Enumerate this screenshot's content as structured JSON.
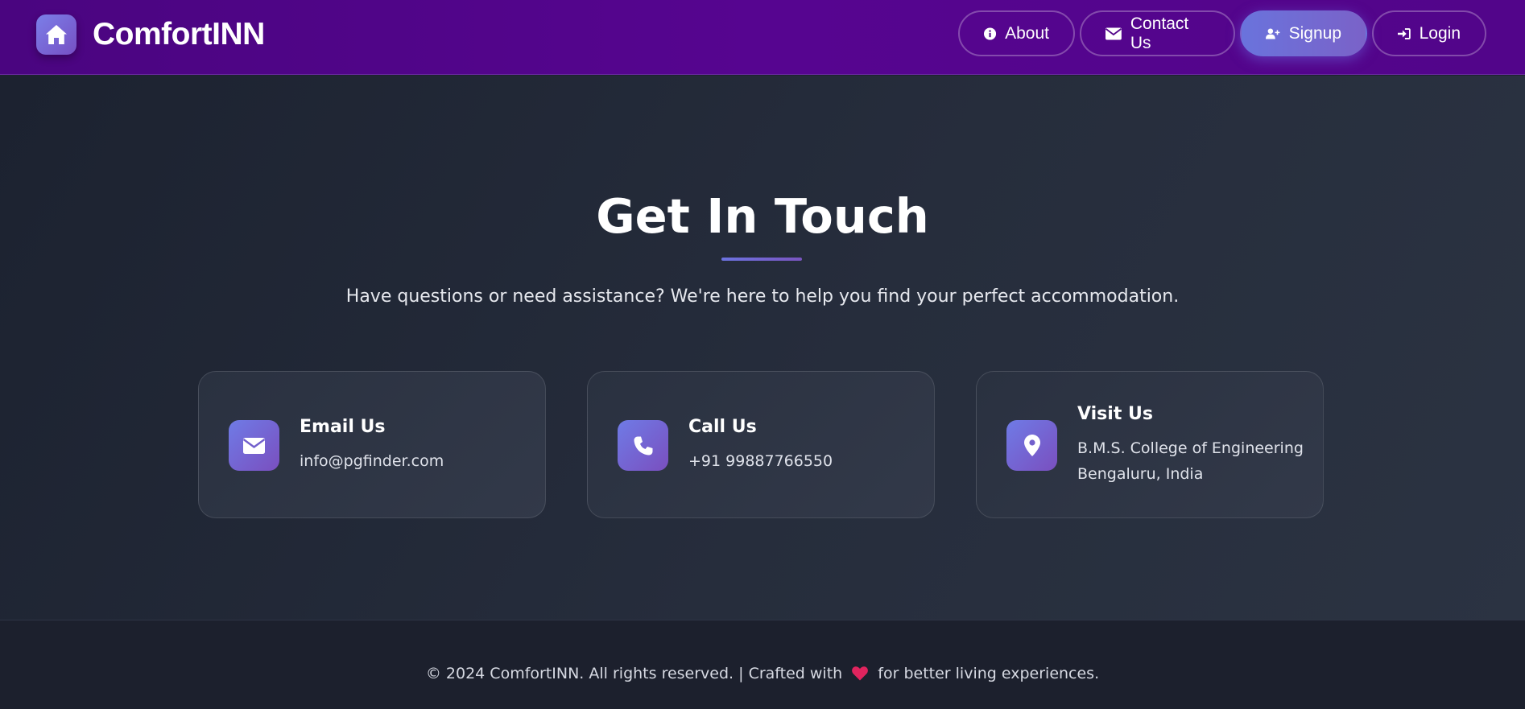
{
  "brand": {
    "name": "ComfortINN",
    "icon": "home-icon"
  },
  "nav": {
    "items": [
      {
        "label": "About",
        "icon": "info-icon"
      },
      {
        "label": "Contact Us",
        "icon": "envelope-icon"
      },
      {
        "label": "Signup",
        "icon": "user-plus-icon"
      },
      {
        "label": "Login",
        "icon": "sign-in-icon"
      }
    ]
  },
  "main": {
    "title": "Get In Touch",
    "subtitle": "Have questions or need assistance? We're here to help you find your perfect accommodation.",
    "cards": [
      {
        "title": "Email Us",
        "lines": [
          "info@pgfinder.com"
        ],
        "icon": "envelope-icon"
      },
      {
        "title": "Call Us",
        "lines": [
          "+91 99887766550"
        ],
        "icon": "phone-icon"
      },
      {
        "title": "Visit Us",
        "lines": [
          "B.M.S. College of Engineering",
          "Bengaluru, India"
        ],
        "icon": "map-pin-icon"
      }
    ]
  },
  "footer": {
    "text_before": "© 2024 ComfortINN. All rights reserved. | Crafted with",
    "text_after": "for better living experiences.",
    "icon": "heart-icon"
  },
  "colors": {
    "navbar": "#52058a",
    "accent": "#6c73e0",
    "accent_end": "#7a4fbf",
    "background": "#1e2330",
    "footer": "#1c202d",
    "heart": "#e0245e"
  }
}
